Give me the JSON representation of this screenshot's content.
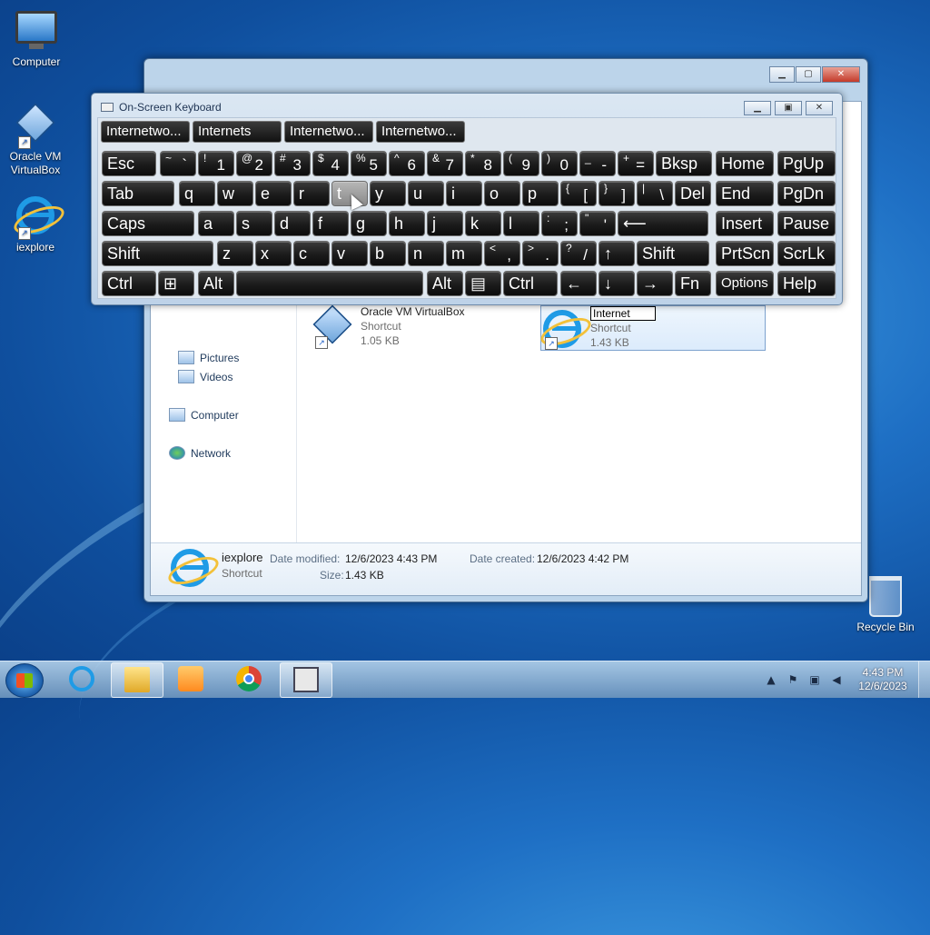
{
  "desktop": {
    "icons": [
      {
        "label": "Computer"
      },
      {
        "label": "Oracle VM VirtualBox"
      },
      {
        "label": "iexplore"
      },
      {
        "label": "Recycle Bin"
      }
    ]
  },
  "explorer": {
    "nav": [
      "Pictures",
      "Videos",
      "Computer",
      "Network"
    ],
    "files": [
      {
        "name": "Oracle VM VirtualBox",
        "type": "Shortcut",
        "size": "1.05 KB"
      },
      {
        "name": "Internet",
        "type": "Shortcut",
        "size": "1.43 KB"
      }
    ],
    "details": {
      "name": "iexplore",
      "type": "Shortcut",
      "modified_label": "Date modified:",
      "modified_value": "12/6/2023 4:43 PM",
      "created_label": "Date created:",
      "created_value": "12/6/2023 4:42 PM",
      "size_label": "Size:",
      "size_value": "1.43 KB"
    }
  },
  "osk": {
    "title": "On-Screen Keyboard",
    "predictions": [
      "Internetwo...",
      "Internets",
      "Internetwo...",
      "Internetwo..."
    ],
    "row1": [
      {
        "l": "Esc"
      },
      {
        "s": "~",
        "m": "`"
      },
      {
        "s": "!",
        "m": "1"
      },
      {
        "s": "@",
        "m": "2"
      },
      {
        "s": "#",
        "m": "3"
      },
      {
        "s": "$",
        "m": "4"
      },
      {
        "s": "%",
        "m": "5"
      },
      {
        "s": "^",
        "m": "6"
      },
      {
        "s": "&",
        "m": "7"
      },
      {
        "s": "*",
        "m": "8"
      },
      {
        "s": "(",
        "m": "9"
      },
      {
        "s": ")",
        "m": "0"
      },
      {
        "s": "_",
        "m": "-"
      },
      {
        "s": "+",
        "m": "="
      },
      {
        "l": "Bksp"
      },
      {
        "l": "Home"
      },
      {
        "l": "PgUp"
      }
    ],
    "row2": [
      {
        "l": "Tab"
      },
      {
        "l": "q"
      },
      {
        "l": "w"
      },
      {
        "l": "e"
      },
      {
        "l": "r"
      },
      {
        "l": "t"
      },
      {
        "l": "y"
      },
      {
        "l": "u"
      },
      {
        "l": "i"
      },
      {
        "l": "o"
      },
      {
        "l": "p"
      },
      {
        "s": "{",
        "m": "["
      },
      {
        "s": "}",
        "m": "]"
      },
      {
        "s": "|",
        "m": "\\"
      },
      {
        "l": "Del"
      },
      {
        "l": "End"
      },
      {
        "l": "PgDn"
      }
    ],
    "row3": [
      {
        "l": "Caps"
      },
      {
        "l": "a"
      },
      {
        "l": "s"
      },
      {
        "l": "d"
      },
      {
        "l": "f"
      },
      {
        "l": "g"
      },
      {
        "l": "h"
      },
      {
        "l": "j"
      },
      {
        "l": "k"
      },
      {
        "l": "l"
      },
      {
        "s": ":",
        "m": ";"
      },
      {
        "s": "\"",
        "m": "'"
      },
      {
        "l": "⟵"
      },
      {
        "l": "Insert"
      },
      {
        "l": "Pause"
      }
    ],
    "row4": [
      {
        "l": "Shift"
      },
      {
        "l": "z"
      },
      {
        "l": "x"
      },
      {
        "l": "c"
      },
      {
        "l": "v"
      },
      {
        "l": "b"
      },
      {
        "l": "n"
      },
      {
        "l": "m"
      },
      {
        "s": "<",
        "m": ","
      },
      {
        "s": ">",
        "m": "."
      },
      {
        "s": "?",
        "m": "/"
      },
      {
        "l": "↑"
      },
      {
        "l": "Shift"
      },
      {
        "l": "PrtScn"
      },
      {
        "l": "ScrLk"
      }
    ],
    "row5": [
      {
        "l": "Ctrl"
      },
      {
        "l": "⊞"
      },
      {
        "l": "Alt"
      },
      {
        "l": ""
      },
      {
        "l": "Alt"
      },
      {
        "l": "▤"
      },
      {
        "l": "Ctrl"
      },
      {
        "l": "←"
      },
      {
        "l": "↓"
      },
      {
        "l": "→"
      },
      {
        "l": "Fn"
      },
      {
        "l": "Options"
      },
      {
        "l": "Help"
      }
    ]
  },
  "taskbar": {
    "time": "4:43 PM",
    "date": "12/6/2023"
  }
}
